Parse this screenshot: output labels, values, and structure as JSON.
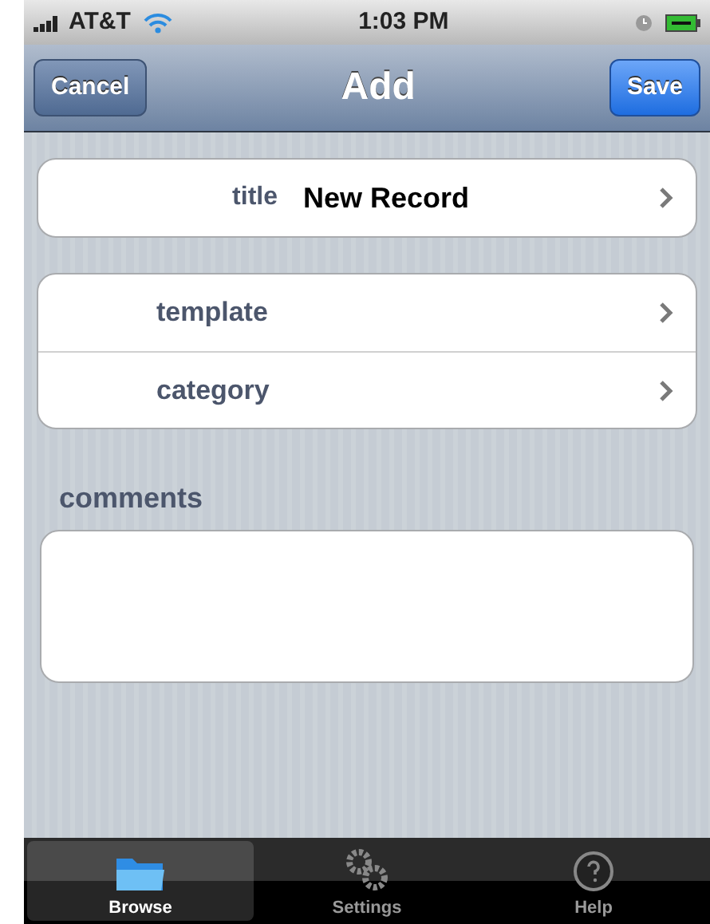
{
  "status_bar": {
    "carrier": "AT&T",
    "time": "1:03 PM"
  },
  "nav_bar": {
    "title": "Add",
    "left_button": "Cancel",
    "right_button": "Save"
  },
  "groups": [
    {
      "rows": [
        {
          "label": "title",
          "value": "New Record"
        }
      ]
    },
    {
      "rows": [
        {
          "label": "template"
        },
        {
          "label": "category"
        }
      ]
    }
  ],
  "comments": {
    "label": "comments"
  },
  "tab_bar": [
    {
      "label": "Browse",
      "kind": "folder",
      "selected": true
    },
    {
      "label": "Settings",
      "kind": "gears",
      "selected": false
    },
    {
      "label": "Help",
      "kind": "help",
      "selected": false
    }
  ]
}
